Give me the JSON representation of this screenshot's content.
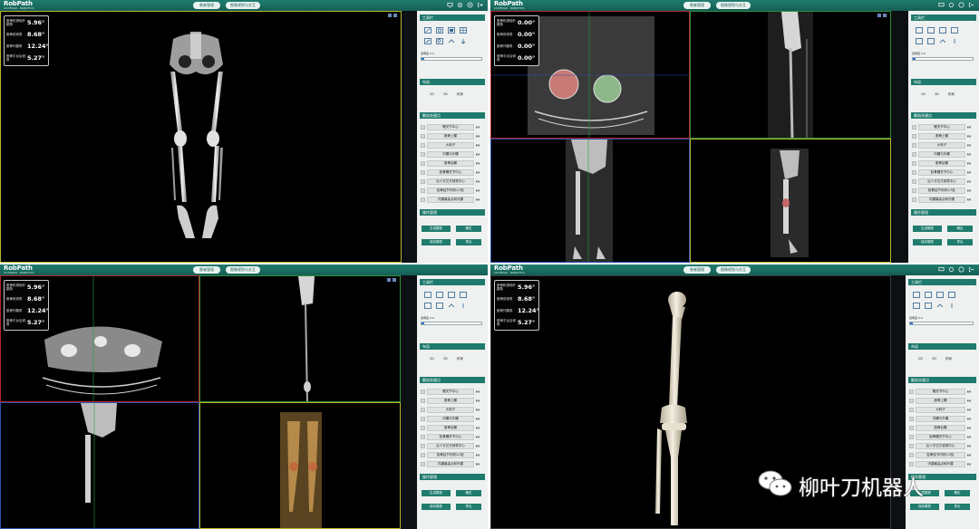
{
  "app": {
    "logo": "RobPath",
    "logo_sub": "LIUYEDAO · ROBOTICS",
    "header_buttons": [
      "患者管理",
      "图像规划与交互"
    ]
  },
  "angles": [
    {
      "label": "股骨机械轴外翻角",
      "value": "5.96°"
    },
    {
      "label": "股骨前倾角",
      "value": "8.68°"
    },
    {
      "label": "股骨外翻角",
      "value": "12.24°"
    },
    {
      "label": "股骨平台后倾角",
      "value": "5.27°"
    }
  ],
  "angles_zero": [
    {
      "label": "股骨机械轴外翻角",
      "value": "0.00°"
    },
    {
      "label": "股骨前倾角",
      "value": "0.00°"
    },
    {
      "label": "股骨外翻角",
      "value": "0.00°"
    },
    {
      "label": "股骨平台后倾角",
      "value": "0.00°"
    }
  ],
  "panel": {
    "tools_title": "工具栏",
    "slider_label": "透明度 0.0",
    "opacity_fraction": 0.05,
    "layout_title": "布局",
    "layout_options": [
      "2D",
      "3D",
      "布局"
    ],
    "landmarks_title": "解剖关键点",
    "landmarks": [
      "髋关节中心",
      "股骨上髁",
      "大转子",
      "内髁与外髁",
      "股骨后髁",
      "胫骨髁关节中心",
      "后十字交叉韧带中心",
      "胫骨结节内侧1/3处",
      "内踝最高点和外踝"
    ],
    "landmark_tag": "▮▮▮",
    "ops_title": "操作管理",
    "ops_buttons": [
      "生成模型",
      "确定",
      "保存模型",
      "导出"
    ]
  },
  "watermark": {
    "text": "柳叶刀机器人",
    "icon": "wechat-icon"
  }
}
